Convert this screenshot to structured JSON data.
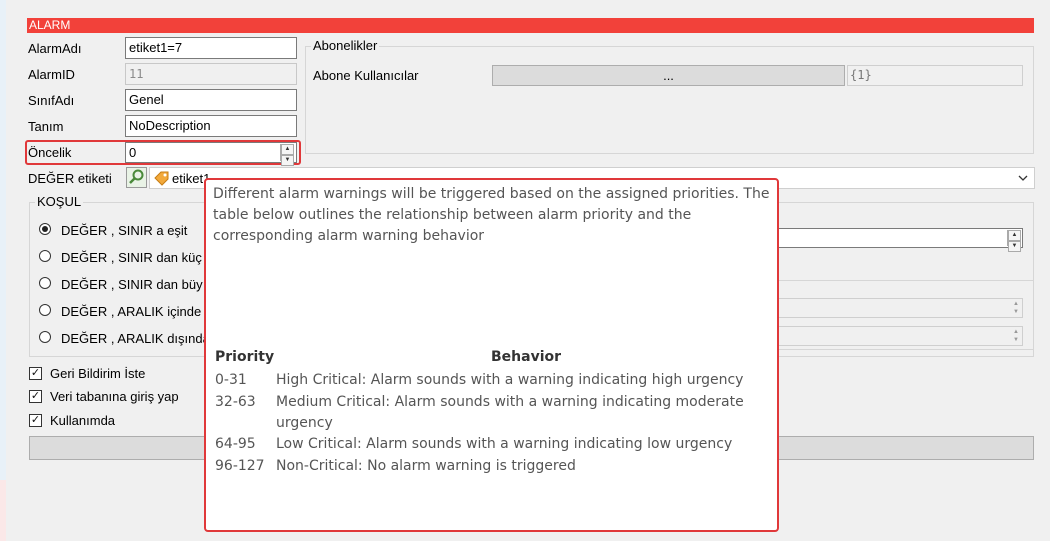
{
  "window": {
    "title": "ALARM"
  },
  "form": {
    "alarm_adi": {
      "label": "AlarmAdı",
      "value": "etiket1=7"
    },
    "alarm_id": {
      "label": "AlarmID",
      "value": "11"
    },
    "sinif_adi": {
      "label": "SınıfAdı",
      "value": "Genel"
    },
    "tanim": {
      "label": "Tanım",
      "value": "NoDescription"
    },
    "oncelik": {
      "label": "Öncelik",
      "value": "0"
    },
    "deger_etiketi": {
      "label": "DEĞER etiketi",
      "value": "etiket1"
    }
  },
  "subscriptions": {
    "group_label": "Abonelikler",
    "users_label": "Abone Kullanıcılar",
    "browse_button": "...",
    "users_value": "{1}"
  },
  "condition": {
    "group_label": "KOŞUL",
    "options": [
      {
        "label": "DEĞER , SINIR a eşit",
        "selected": true
      },
      {
        "label": "DEĞER , SINIR dan küç",
        "selected": false
      },
      {
        "label": "DEĞER , SINIR dan büy",
        "selected": false
      },
      {
        "label": "DEĞER , ARALIK içinde",
        "selected": false
      },
      {
        "label": "DEĞER , ARALIK dışında",
        "selected": false
      }
    ]
  },
  "checkboxes": [
    {
      "label": "Geri Bildirim İste",
      "checked": true
    },
    {
      "label": "Veri tabanına giriş yap",
      "checked": true
    },
    {
      "label": "Kullanımda",
      "checked": true
    }
  ],
  "tooltip": {
    "intro": "Different alarm warnings will be triggered based on the assigned priorities. The table below outlines the relationship between alarm priority and the corresponding alarm warning behavior",
    "headers": {
      "priority": "Priority",
      "behavior": "Behavior"
    },
    "rows": [
      {
        "priority": "0-31",
        "behavior": "High Critical: Alarm sounds with a warning indicating high urgency"
      },
      {
        "priority": "32-63",
        "behavior": "Medium Critical: Alarm sounds with a warning indicating moderate urgency"
      },
      {
        "priority": "64-95",
        "behavior": "Low Critical: Alarm sounds with a warning indicating low urgency"
      },
      {
        "priority": "96-127",
        "behavior": "Non-Critical: No alarm warning is triggered"
      }
    ]
  },
  "colors": {
    "accent": "#f2413a",
    "highlight_border": "#e0383a"
  },
  "icons": {
    "search": "search-icon",
    "tag": "tag-icon",
    "dropdown": "chevron-down-icon"
  }
}
